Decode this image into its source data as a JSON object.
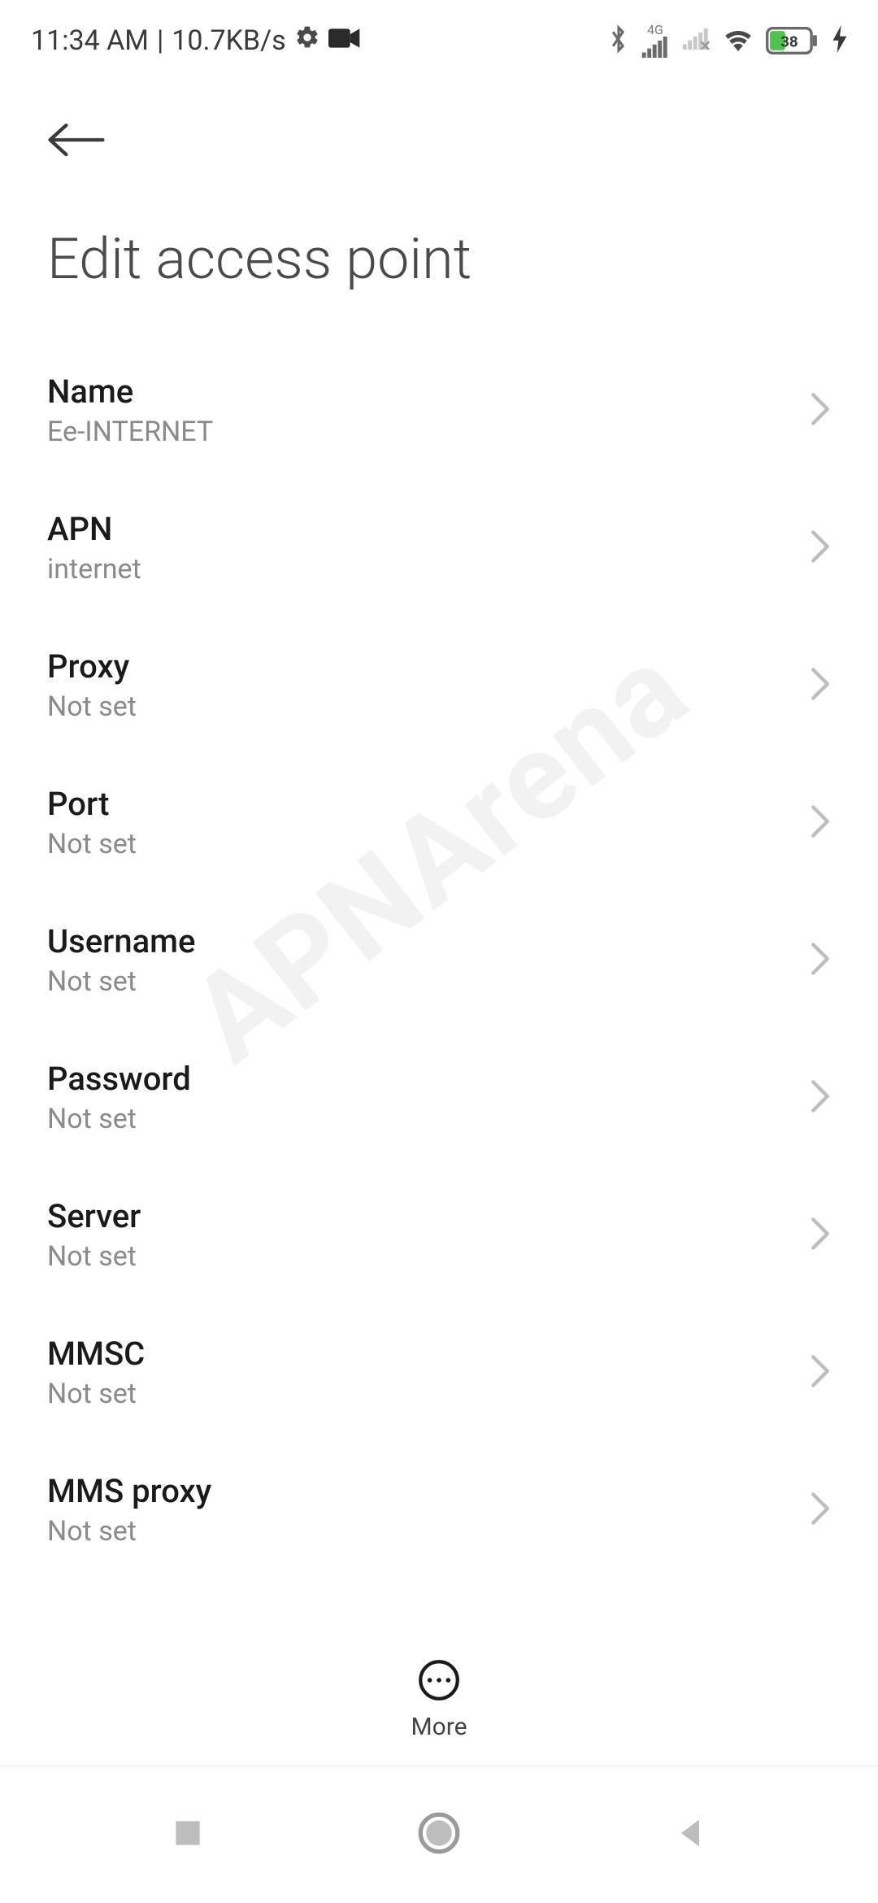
{
  "status": {
    "time": "11:34 AM",
    "speed": "10.7KB/s",
    "network_label": "4G",
    "battery_percent": "38"
  },
  "header": {
    "title": "Edit access point"
  },
  "rows": [
    {
      "label": "Name",
      "value": "Ee-INTERNET"
    },
    {
      "label": "APN",
      "value": "internet"
    },
    {
      "label": "Proxy",
      "value": "Not set"
    },
    {
      "label": "Port",
      "value": "Not set"
    },
    {
      "label": "Username",
      "value": "Not set"
    },
    {
      "label": "Password",
      "value": "Not set"
    },
    {
      "label": "Server",
      "value": "Not set"
    },
    {
      "label": "MMSC",
      "value": "Not set"
    },
    {
      "label": "MMS proxy",
      "value": "Not set"
    }
  ],
  "bottom": {
    "more_label": "More"
  },
  "watermark": "APNArena"
}
